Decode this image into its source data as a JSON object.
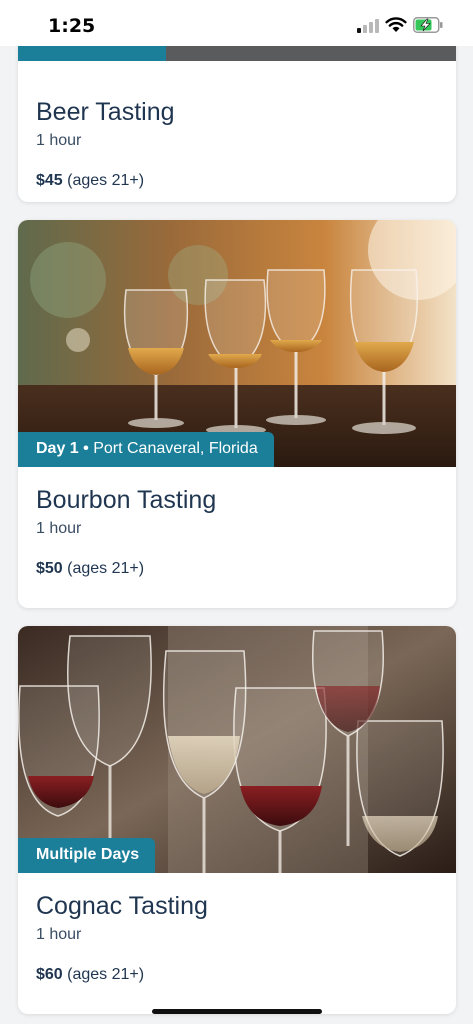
{
  "status_bar": {
    "time": "1:25"
  },
  "cards": [
    {
      "title": "Beer Tasting",
      "duration": "1 hour",
      "price": "$45",
      "price_note": "(ages 21+)"
    },
    {
      "badge_day": "Day 1",
      "badge_location": "Port Canaveral, Florida",
      "title": "Bourbon Tasting",
      "duration": "1 hour",
      "price": "$50",
      "price_note": "(ages 21+)"
    },
    {
      "badge": "Multiple Days",
      "title": "Cognac Tasting",
      "duration": "1 hour",
      "price": "$60",
      "price_note": "(ages 21+)"
    }
  ],
  "colors": {
    "accent": "#1b7f99",
    "title_text": "#1f3550",
    "page_background": "#f2f3f5"
  },
  "icons": [
    "cellular-signal-icon",
    "wifi-icon",
    "battery-charging-icon"
  ]
}
